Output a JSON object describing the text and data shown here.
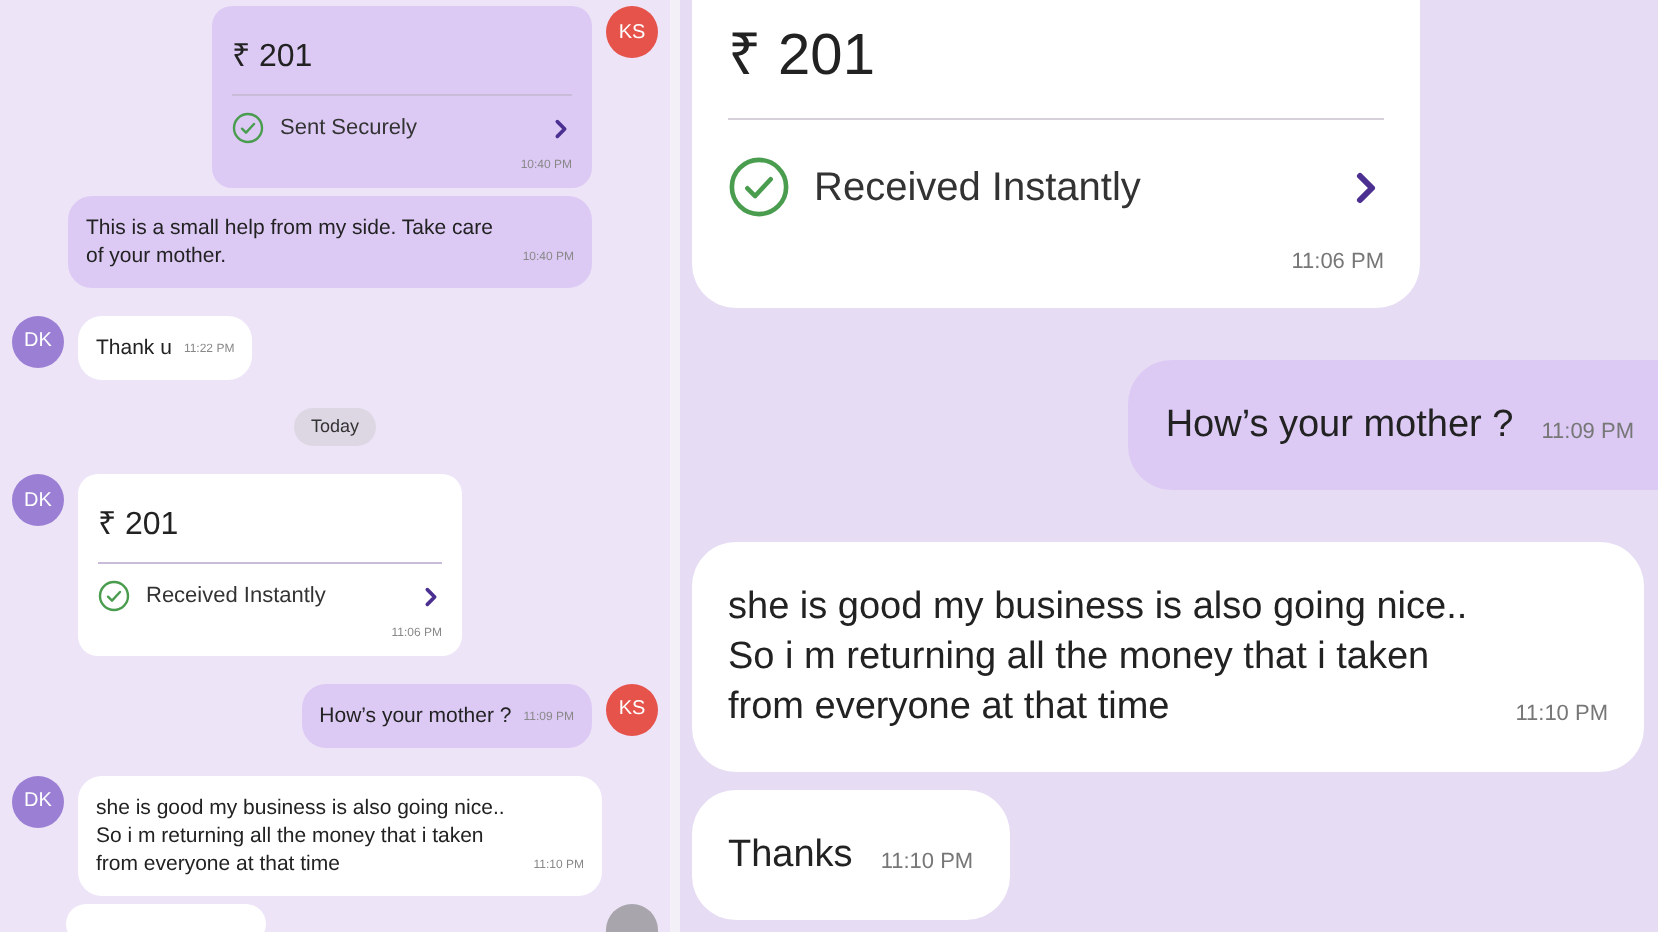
{
  "chat_panel": {
    "messages": [
      {
        "kind": "payment",
        "outgoing": true,
        "avatar": "KS",
        "amount": "₹ 201",
        "status": "Sent Securely",
        "time": "10:40 PM"
      },
      {
        "kind": "text",
        "outgoing": true,
        "text": "This is a small help from my side. Take care of your mother.",
        "time": "10:40 PM"
      },
      {
        "kind": "text",
        "outgoing": false,
        "avatar": "DK",
        "text": "Thank u",
        "time": "11:22 PM"
      },
      {
        "kind": "date",
        "label": "Today"
      },
      {
        "kind": "payment",
        "outgoing": false,
        "avatar": "DK",
        "amount": "₹ 201",
        "status": "Received Instantly",
        "time": "11:06 PM"
      },
      {
        "kind": "text",
        "outgoing": true,
        "avatar": "KS",
        "text": "How’s your mother ?",
        "time": "11:09 PM"
      },
      {
        "kind": "text",
        "outgoing": false,
        "avatar": "DK",
        "text": "she is good my business is also going nice.. So i m returning all the money that i taken from everyone at that time",
        "time": "11:10 PM"
      },
      {
        "kind": "partial",
        "outgoing": false
      }
    ]
  },
  "zoomed_panel": {
    "messages": [
      {
        "kind": "payment",
        "outgoing": false,
        "amount": "₹ 201",
        "status": "Received Instantly",
        "time": "11:06 PM"
      },
      {
        "kind": "text",
        "outgoing": true,
        "text": "How’s your mother ?",
        "time": "11:09 PM"
      },
      {
        "kind": "text",
        "outgoing": false,
        "text": "she is good my business is also going nice.. So i m returning all the money that i taken from everyone at that time",
        "time": "11:10 PM"
      },
      {
        "kind": "text",
        "outgoing": false,
        "text": "Thanks",
        "time": "11:10 PM"
      }
    ]
  }
}
